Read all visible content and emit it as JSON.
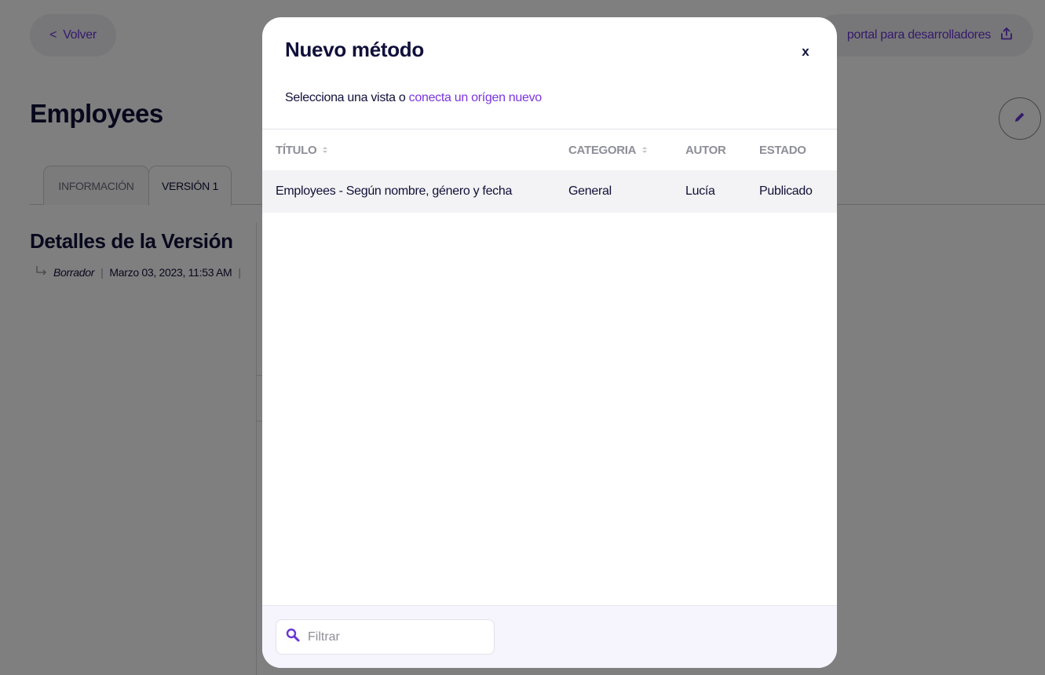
{
  "page": {
    "back_label": "Volver",
    "back_chevron": "<",
    "devportal_label": "portal para desarrolladores",
    "title": "Employees",
    "tabs": [
      {
        "label": "INFORMACIÓN"
      },
      {
        "label": "VERSIÓN 1"
      }
    ],
    "details_title": "Detalles de la Versión",
    "details_status": "Borrador",
    "details_date": "Marzo 03, 2023, 11:53 AM",
    "separator": "|"
  },
  "modal": {
    "title": "Nuevo método",
    "close_label": "x",
    "subtitle_prefix": "Selecciona una vista o",
    "subtitle_link": "conecta un orígen nuevo",
    "columns": [
      {
        "label": "TÍTULO",
        "sortable": true
      },
      {
        "label": "CATEGORIA",
        "sortable": true
      },
      {
        "label": "AUTOR",
        "sortable": false
      },
      {
        "label": "ESTADO",
        "sortable": false
      }
    ],
    "rows": [
      {
        "title": "Employees - Según nombre, género y fecha",
        "category": "General",
        "author": "Lucía",
        "status": "Publicado"
      }
    ],
    "filter_placeholder": "Filtrar"
  },
  "colors": {
    "accent": "#7b35e0",
    "text": "#10103a",
    "muted": "#8e8e98",
    "overlay": "rgba(0,0,0,0.5)"
  },
  "icons": [
    "chevron-left-icon",
    "share-icon",
    "pencil-icon",
    "return-arrow-icon",
    "sort-icon",
    "close-icon",
    "search-icon"
  ]
}
